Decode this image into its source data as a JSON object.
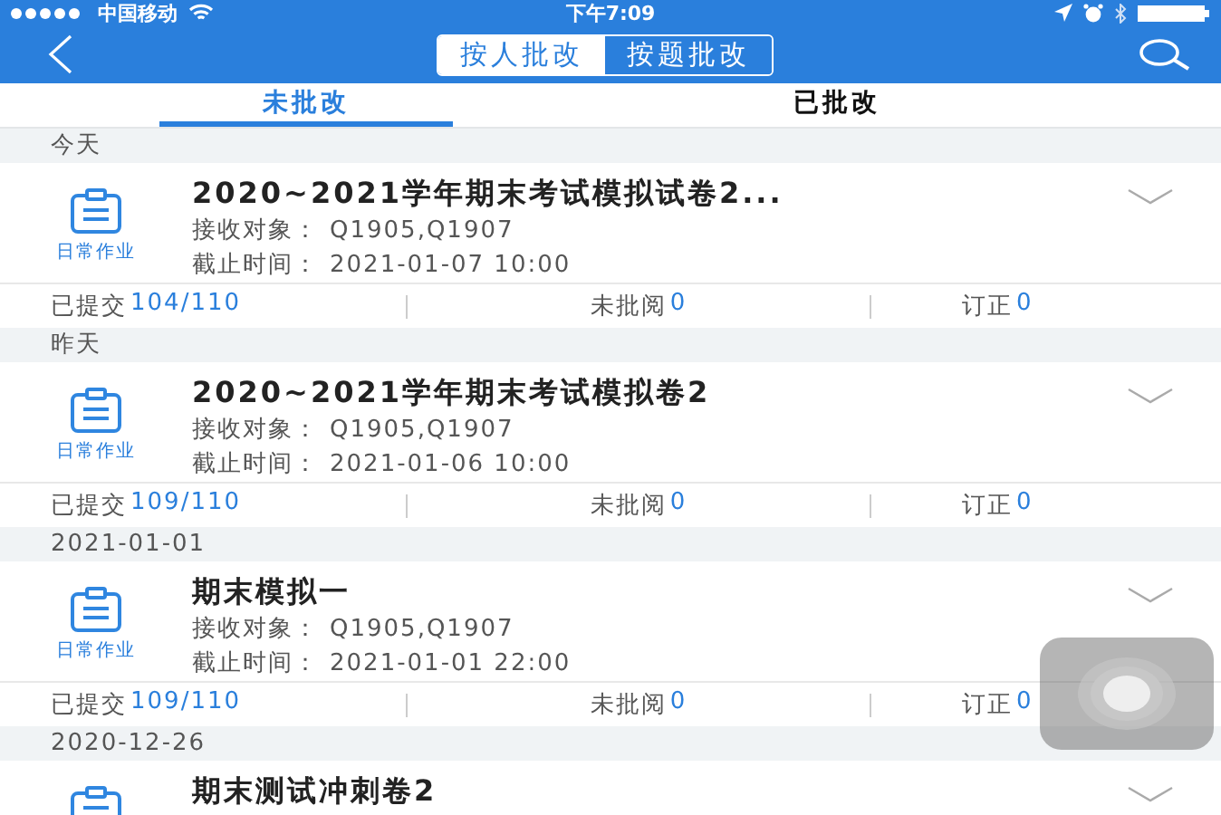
{
  "status_bar": {
    "carrier": "中国移动",
    "time": "下午7:09"
  },
  "segments": [
    {
      "label": "按人批改",
      "selected": true
    },
    {
      "label": "按题批改",
      "selected": false
    }
  ],
  "tabs": [
    {
      "label": "未批改",
      "selected": true
    },
    {
      "label": "已批改",
      "selected": false
    }
  ],
  "groups": [
    {
      "date": "今天",
      "cards": [
        {
          "tag": "日常作业",
          "title": "2020~2021学年期末考试模拟试卷2...",
          "recipients_label": "接收对象：",
          "recipients": "Q1905,Q1907",
          "deadline_label": "截止时间：",
          "deadline": "2021-01-07 10:00",
          "submitted_label": "已提交",
          "submitted": "104/110",
          "unread_label": "未批阅",
          "unread": "0",
          "correct_label": "订正",
          "correct": "0"
        }
      ]
    },
    {
      "date": "昨天",
      "cards": [
        {
          "tag": "日常作业",
          "title": "2020~2021学年期末考试模拟卷2",
          "recipients_label": "接收对象：",
          "recipients": "Q1905,Q1907",
          "deadline_label": "截止时间：",
          "deadline": "2021-01-06 10:00",
          "submitted_label": "已提交",
          "submitted": "109/110",
          "unread_label": "未批阅",
          "unread": "0",
          "correct_label": "订正",
          "correct": "0"
        }
      ]
    },
    {
      "date": "2021-01-01",
      "cards": [
        {
          "tag": "日常作业",
          "title": "期末模拟一",
          "recipients_label": "接收对象：",
          "recipients": "Q1905,Q1907",
          "deadline_label": "截止时间：",
          "deadline": "2021-01-01 22:00",
          "submitted_label": "已提交",
          "submitted": "109/110",
          "unread_label": "未批阅",
          "unread": "0",
          "correct_label": "订正",
          "correct": "0"
        }
      ]
    },
    {
      "date": "2020-12-26",
      "cards": [
        {
          "title": "期末测试冲刺卷2"
        }
      ]
    }
  ]
}
